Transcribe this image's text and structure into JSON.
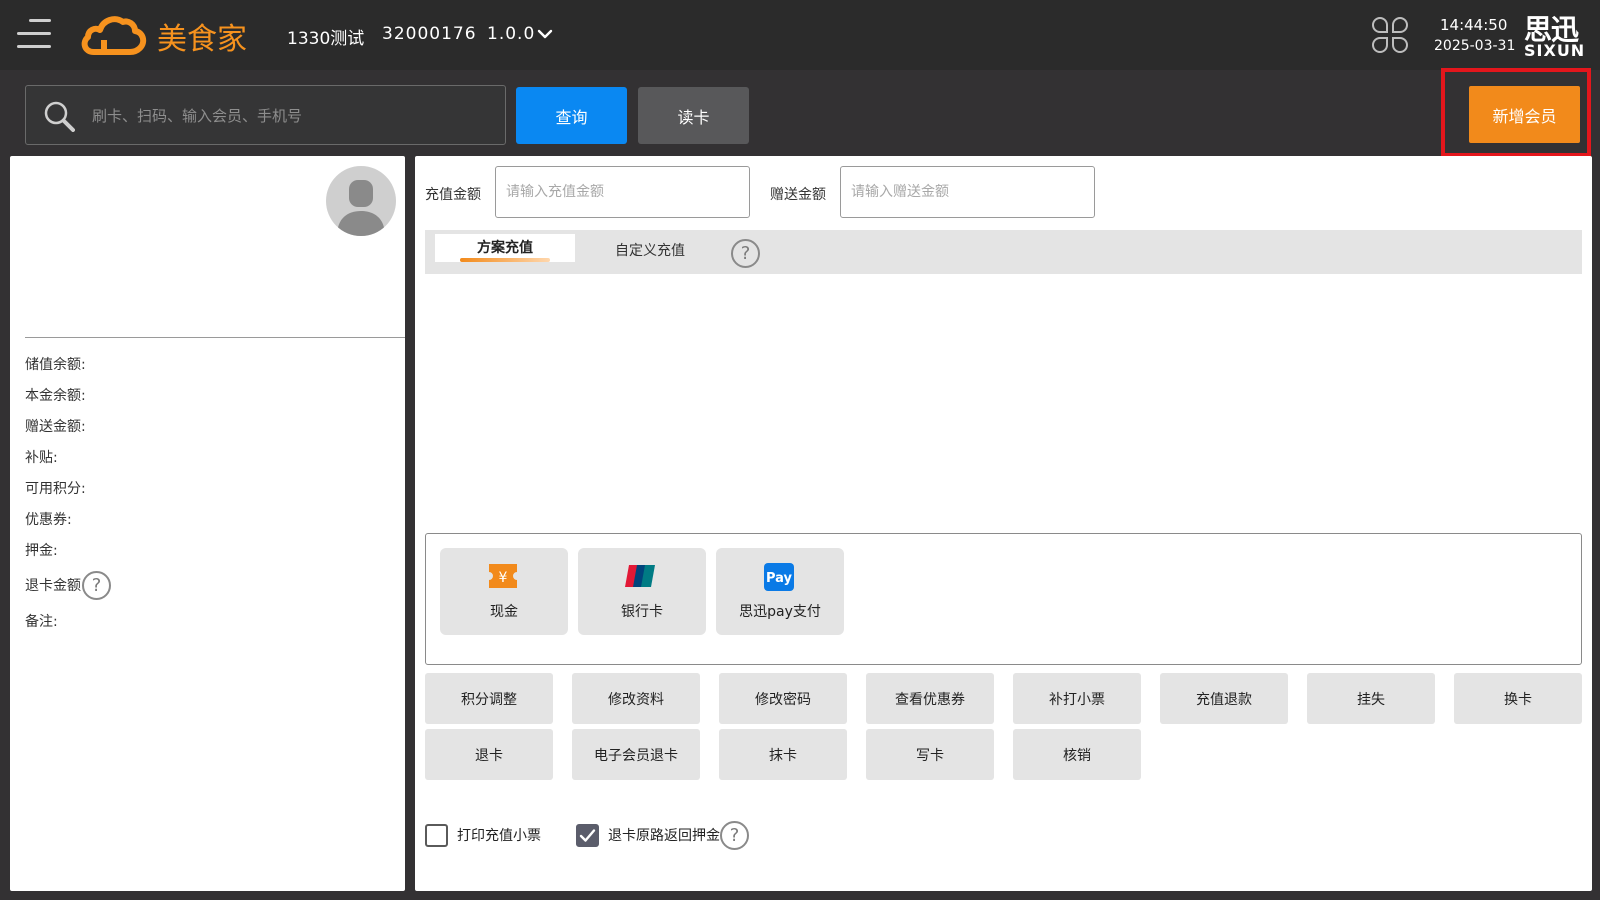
{
  "header": {
    "brand": "美食家",
    "store_name": "1330测试",
    "store_code": "32000176",
    "version": "1.0.0",
    "time": "14:44:50",
    "date": "2025-03-31",
    "vendor_cn": "思迅",
    "vendor_en": "SIXUN"
  },
  "search": {
    "placeholder": "刷卡、扫码、输入会员、手机号",
    "query_label": "查询",
    "read_card_label": "读卡",
    "add_member_label": "新增会员"
  },
  "member_info": {
    "fields": [
      "储值余额:",
      "本金余额:",
      "赠送金额:",
      "补贴:",
      "可用积分:",
      "优惠券:",
      "押金:",
      "退卡金额",
      "备注:"
    ]
  },
  "recharge": {
    "amount_label": "充值金额",
    "amount_placeholder": "请输入充值金额",
    "gift_label": "赠送金额",
    "gift_placeholder": "请输入赠送金额",
    "tabs": [
      "方案充值",
      "自定义充值"
    ]
  },
  "payment_methods": [
    "现金",
    "银行卡",
    "思迅pay支付"
  ],
  "actions": [
    "积分调整",
    "修改资料",
    "修改密码",
    "查看优惠券",
    "补打小票",
    "充值退款",
    "挂失",
    "换卡",
    "退卡",
    "电子会员退卡",
    "抹卡",
    "写卡",
    "核销"
  ],
  "options": {
    "print_receipt": "打印充值小票",
    "print_receipt_checked": false,
    "refund_deposit": "退卡原路返回押金",
    "refund_deposit_checked": true
  },
  "colors": {
    "accent_orange": "#f28a1b",
    "query_blue": "#0a88f2",
    "highlight_red": "#e4161c"
  }
}
